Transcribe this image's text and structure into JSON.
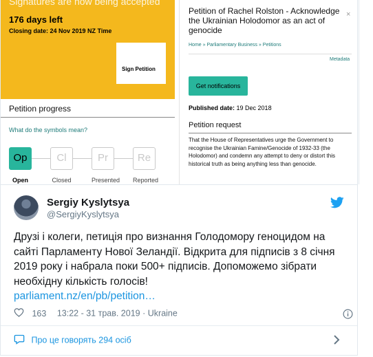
{
  "petition_page": {
    "sidebar": {
      "cut_text": "Signatures are now being accepted",
      "days_left": "176 days left",
      "closing_date": "Closing date: 24 Nov 2019 NZ Time",
      "sign_label": "Sign Petition",
      "accent_color": "#f4b81d"
    },
    "progress": {
      "title": "Petition progress",
      "symbols_link": "What do the symbols mean?",
      "steps": [
        {
          "abbr": "Op",
          "label": "Open",
          "active": true
        },
        {
          "abbr": "Cl",
          "label": "Closed",
          "active": false
        },
        {
          "abbr": "Pr",
          "label": "Presented",
          "active": false
        },
        {
          "abbr": "Re",
          "label": "Reported",
          "active": false
        }
      ]
    },
    "main": {
      "title": "Petition of Rachel Rolston - Acknowledge the Ukrainian Holodomor as an act of genocide",
      "close_glyph": "×",
      "breadcrumb": "Home » Parliamentary Business » Petitions",
      "metadata_link": "Metadata",
      "notifications_button": "Get notifications",
      "published_label": "Published date:",
      "published_value": "19 Dec 2018",
      "request_title": "Petition request",
      "request_text": "That the House of Representatives urge the Government to recognise the Ukrainian Famine/Genocide of 1932-33 (the Holodomor) and condemn any attempt to deny or distort this historical truth as being anything less than genocide.",
      "button_color": "#28b59c"
    }
  },
  "tweet": {
    "author_name": "Sergiy Kyslytsya",
    "author_handle": "@SergiyKyslytsya",
    "text": "Друзі і колеги, петиція про визнання Голодомору геноцидом на сайті Парламенту Нової Зеландії. Відкрита для підписів з 8 січня 2019 року і набрала поки 500+ підписів. Допоможемо зібрати необхідну кількість голосів!",
    "link": "parliament.nz/en/pb/petition…",
    "likes": "163",
    "timestamp": "13:22 - 31 трав. 2019",
    "separator": "·",
    "location": "Ukraine",
    "footer_link": "Про це говорять 294 осіб",
    "link_color": "#1b95e0",
    "icons": [
      "twitter-bird-icon",
      "heart-icon",
      "info-icon",
      "comment-bubble-icon",
      "chevron-right-icon"
    ]
  }
}
